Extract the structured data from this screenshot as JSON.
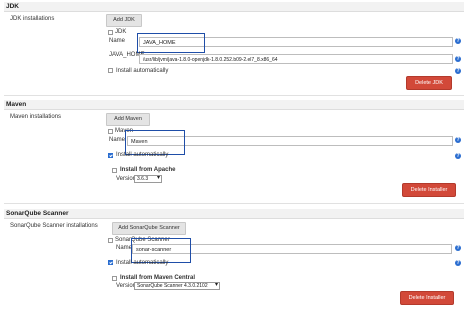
{
  "jdk": {
    "section_title": "JDK",
    "installations_label": "JDK installations",
    "add_button": "Add JDK",
    "item_header": "JDK",
    "name_label": "Name",
    "name_value": "JAVA_HOME",
    "home_label": "JAVA_HOME",
    "home_value": "/usr/lib/jvm/java-1.8.0-openjdk-1.8.0.252.b09-2.el7_8.x86_64",
    "install_auto_label": "Install automatically",
    "delete_button": "Delete JDK"
  },
  "maven": {
    "section_title": "Maven",
    "installations_label": "Maven installations",
    "add_button": "Add Maven",
    "item_header": "Maven",
    "name_label": "Name",
    "name_value": "Maven",
    "install_auto_label": "Install automatically",
    "install_from_label": "Install from Apache",
    "version_label": "Version",
    "version_value": "3.6.3",
    "delete_button": "Delete Installer"
  },
  "sonar": {
    "section_title": "SonarQube Scanner",
    "installations_label": "SonarQube Scanner installations",
    "add_button": "Add SonarQube Scanner",
    "item_header": "SonarQube Scanner",
    "name_label": "Name",
    "name_value": "sonar-scanner",
    "install_auto_label": "Install automatically",
    "install_from_label": "Install from Maven Central",
    "version_label": "Version",
    "version_value": "SonarQube Scanner 4.3.0.2102",
    "delete_button": "Delete Installer"
  },
  "help_icon_glyph": "?",
  "colors": {
    "delete": "#d24939",
    "highlight": "#1f4ea8",
    "accent": "#2a6dd0"
  }
}
